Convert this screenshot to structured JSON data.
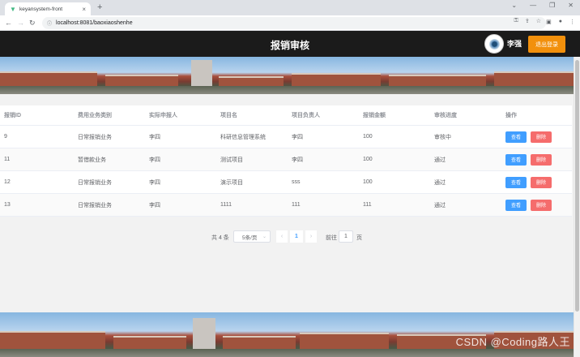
{
  "browser": {
    "tab_title": "keyansystem-front",
    "new_tab_label": "+",
    "url": "localhost:8081/baoxiaoshenhe"
  },
  "header": {
    "title": "报销审核",
    "username": "李强",
    "logout_label": "退出登录"
  },
  "table": {
    "columns": [
      "报销ID",
      "费用业务类别",
      "实际申报人",
      "项目名",
      "项目负责人",
      "报销金额",
      "审核进度",
      "操作"
    ],
    "rows": [
      {
        "id": "9",
        "category": "日常报销业务",
        "applicant": "李四",
        "project": "科研信息管理系统",
        "leader": "李四",
        "amount": "100",
        "status": "审核中"
      },
      {
        "id": "11",
        "category": "暂借款业务",
        "applicant": "李四",
        "project": "测试项目",
        "leader": "李四",
        "amount": "100",
        "status": "通过"
      },
      {
        "id": "12",
        "category": "日常报销业务",
        "applicant": "李四",
        "project": "演示项目",
        "leader": "sss",
        "amount": "100",
        "status": "通过"
      },
      {
        "id": "13",
        "category": "日常报销业务",
        "applicant": "李四",
        "project": "1111",
        "leader": "111",
        "amount": "111",
        "status": "通过"
      }
    ],
    "view_label": "查看",
    "delete_label": "删除"
  },
  "pagination": {
    "total": "共 4 条",
    "page_size": "5条/页",
    "current_page": "1",
    "goto_label": "前往",
    "goto_value": "1",
    "page_unit": "页"
  },
  "watermark": "CSDN @Coding路人王",
  "colors": {
    "primary": "#409eff",
    "danger": "#f56c6c",
    "logout": "#f2900c",
    "header_bg": "#1b1b1b"
  }
}
